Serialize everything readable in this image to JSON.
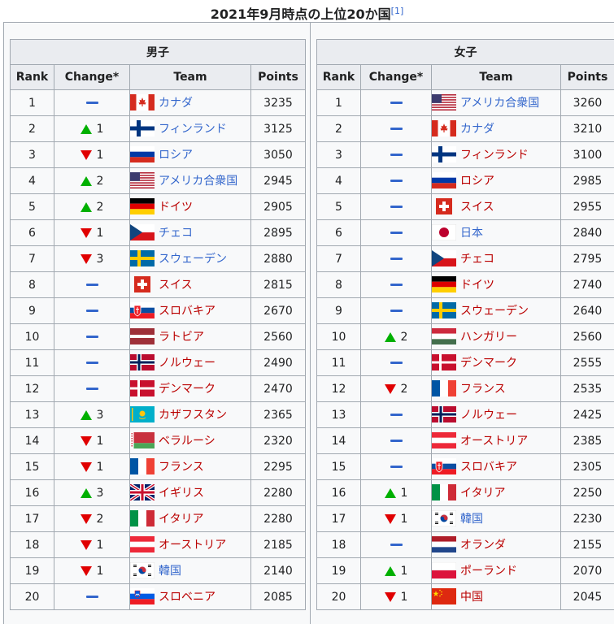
{
  "caption": "2021年9月時点の上位20か国",
  "caption_ref": "[1]",
  "colors": {
    "up": "#00b000",
    "down": "#e00000",
    "same": "#3366cc",
    "link": "#3366cc",
    "new_link": "#ba0000"
  },
  "columns": {
    "rank": "Rank",
    "change": "Change*",
    "team": "Team",
    "points": "Points"
  },
  "men": {
    "title": "男子",
    "rows": [
      {
        "rank": "1",
        "dir": "same",
        "chg": "",
        "team": "カナダ",
        "flag": "canada",
        "points": "3235",
        "color": "link"
      },
      {
        "rank": "2",
        "dir": "up",
        "chg": "1",
        "team": "フィンランド",
        "flag": "finland",
        "points": "3125",
        "color": "link"
      },
      {
        "rank": "3",
        "dir": "down",
        "chg": "1",
        "team": "ロシア",
        "flag": "russia",
        "points": "3050",
        "color": "link"
      },
      {
        "rank": "4",
        "dir": "up",
        "chg": "2",
        "team": "アメリカ合衆国",
        "flag": "usa",
        "points": "2945",
        "color": "link"
      },
      {
        "rank": "5",
        "dir": "up",
        "chg": "2",
        "team": "ドイツ",
        "flag": "germany",
        "points": "2905",
        "color": "new_link"
      },
      {
        "rank": "6",
        "dir": "down",
        "chg": "1",
        "team": "チェコ",
        "flag": "czech",
        "points": "2895",
        "color": "link"
      },
      {
        "rank": "7",
        "dir": "down",
        "chg": "3",
        "team": "スウェーデン",
        "flag": "sweden",
        "points": "2880",
        "color": "link"
      },
      {
        "rank": "8",
        "dir": "same",
        "chg": "",
        "team": "スイス",
        "flag": "switzerland",
        "points": "2815",
        "color": "new_link"
      },
      {
        "rank": "9",
        "dir": "same",
        "chg": "",
        "team": "スロバキア",
        "flag": "slovakia",
        "points": "2670",
        "color": "new_link"
      },
      {
        "rank": "10",
        "dir": "same",
        "chg": "",
        "team": "ラトビア",
        "flag": "latvia",
        "points": "2560",
        "color": "new_link"
      },
      {
        "rank": "11",
        "dir": "same",
        "chg": "",
        "team": "ノルウェー",
        "flag": "norway",
        "points": "2490",
        "color": "new_link"
      },
      {
        "rank": "12",
        "dir": "same",
        "chg": "",
        "team": "デンマーク",
        "flag": "denmark",
        "points": "2470",
        "color": "new_link"
      },
      {
        "rank": "13",
        "dir": "up",
        "chg": "3",
        "team": "カザフスタン",
        "flag": "kazakhstan",
        "points": "2365",
        "color": "new_link"
      },
      {
        "rank": "14",
        "dir": "down",
        "chg": "1",
        "team": "ベラルーシ",
        "flag": "belarus",
        "points": "2320",
        "color": "new_link"
      },
      {
        "rank": "15",
        "dir": "down",
        "chg": "1",
        "team": "フランス",
        "flag": "france",
        "points": "2295",
        "color": "new_link"
      },
      {
        "rank": "16",
        "dir": "up",
        "chg": "3",
        "team": "イギリス",
        "flag": "uk",
        "points": "2280",
        "color": "new_link"
      },
      {
        "rank": "17",
        "dir": "down",
        "chg": "2",
        "team": "イタリア",
        "flag": "italy",
        "points": "2280",
        "color": "new_link"
      },
      {
        "rank": "18",
        "dir": "down",
        "chg": "1",
        "team": "オーストリア",
        "flag": "austria",
        "points": "2185",
        "color": "new_link"
      },
      {
        "rank": "19",
        "dir": "down",
        "chg": "1",
        "team": "韓国",
        "flag": "korea",
        "points": "2140",
        "color": "link"
      },
      {
        "rank": "20",
        "dir": "same",
        "chg": "",
        "team": "スロベニア",
        "flag": "slovenia",
        "points": "2085",
        "color": "new_link"
      }
    ]
  },
  "women": {
    "title": "女子",
    "rows": [
      {
        "rank": "1",
        "dir": "same",
        "chg": "",
        "team": "アメリカ合衆国",
        "flag": "usa",
        "points": "3260",
        "color": "link"
      },
      {
        "rank": "2",
        "dir": "same",
        "chg": "",
        "team": "カナダ",
        "flag": "canada",
        "points": "3210",
        "color": "link"
      },
      {
        "rank": "3",
        "dir": "same",
        "chg": "",
        "team": "フィンランド",
        "flag": "finland",
        "points": "3100",
        "color": "new_link"
      },
      {
        "rank": "4",
        "dir": "same",
        "chg": "",
        "team": "ロシア",
        "flag": "russia",
        "points": "2985",
        "color": "new_link"
      },
      {
        "rank": "5",
        "dir": "same",
        "chg": "",
        "team": "スイス",
        "flag": "switzerland",
        "points": "2955",
        "color": "new_link"
      },
      {
        "rank": "6",
        "dir": "same",
        "chg": "",
        "team": "日本",
        "flag": "japan",
        "points": "2840",
        "color": "link"
      },
      {
        "rank": "7",
        "dir": "same",
        "chg": "",
        "team": "チェコ",
        "flag": "czech",
        "points": "2795",
        "color": "new_link"
      },
      {
        "rank": "8",
        "dir": "same",
        "chg": "",
        "team": "ドイツ",
        "flag": "germany",
        "points": "2740",
        "color": "new_link"
      },
      {
        "rank": "9",
        "dir": "same",
        "chg": "",
        "team": "スウェーデン",
        "flag": "sweden",
        "points": "2640",
        "color": "new_link"
      },
      {
        "rank": "10",
        "dir": "up",
        "chg": "2",
        "team": "ハンガリー",
        "flag": "hungary",
        "points": "2560",
        "color": "new_link"
      },
      {
        "rank": "11",
        "dir": "same",
        "chg": "",
        "team": "デンマーク",
        "flag": "denmark",
        "points": "2555",
        "color": "new_link"
      },
      {
        "rank": "12",
        "dir": "down",
        "chg": "2",
        "team": "フランス",
        "flag": "france",
        "points": "2535",
        "color": "new_link"
      },
      {
        "rank": "13",
        "dir": "same",
        "chg": "",
        "team": "ノルウェー",
        "flag": "norway",
        "points": "2425",
        "color": "new_link"
      },
      {
        "rank": "14",
        "dir": "same",
        "chg": "",
        "team": "オーストリア",
        "flag": "austria",
        "points": "2385",
        "color": "new_link"
      },
      {
        "rank": "15",
        "dir": "same",
        "chg": "",
        "team": "スロバキア",
        "flag": "slovakia",
        "points": "2305",
        "color": "new_link"
      },
      {
        "rank": "16",
        "dir": "up",
        "chg": "1",
        "team": "イタリア",
        "flag": "italy",
        "points": "2250",
        "color": "new_link"
      },
      {
        "rank": "17",
        "dir": "down",
        "chg": "1",
        "team": "韓国",
        "flag": "korea",
        "points": "2230",
        "color": "link"
      },
      {
        "rank": "18",
        "dir": "same",
        "chg": "",
        "team": "オランダ",
        "flag": "netherlands",
        "points": "2155",
        "color": "new_link"
      },
      {
        "rank": "19",
        "dir": "up",
        "chg": "1",
        "team": "ポーランド",
        "flag": "poland",
        "points": "2070",
        "color": "new_link"
      },
      {
        "rank": "20",
        "dir": "down",
        "chg": "1",
        "team": "中国",
        "flag": "china",
        "points": "2045",
        "color": "new_link"
      }
    ]
  }
}
